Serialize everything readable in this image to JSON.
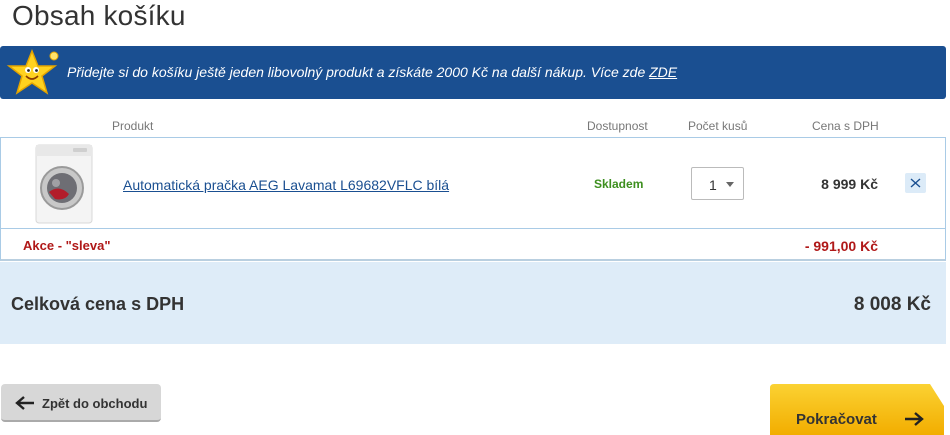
{
  "page_title": "Obsah košíku",
  "promo": {
    "text": "Přidejte si do košíku ještě jeden libovolný produkt a získáte 2000 Kč na další nákup. Více zde ",
    "link": "ZDE"
  },
  "columns": {
    "product": "Produkt",
    "availability": "Dostupnost",
    "quantity": "Počet kusů",
    "price": "Cena s DPH"
  },
  "items": [
    {
      "name": "Automatická pračka AEG Lavamat L69682VFLC bílá",
      "availability": "Skladem",
      "quantity": "1",
      "price": "8 999 Kč"
    }
  ],
  "discount": {
    "label": "Akce - \"sleva\"",
    "value": "- 991,00 Kč"
  },
  "total": {
    "label": "Celková cena s DPH",
    "value": "8 008 Kč"
  },
  "buttons": {
    "back": "Zpět do obchodu",
    "continue": "Pokračovat"
  },
  "colors": {
    "promo_bg": "#1a4f91",
    "available": "#3d8f1f",
    "discount": "#b01818",
    "total_bg": "#deecf8",
    "continue_bg": "#f6bd00"
  },
  "icons": [
    "star-mascot-icon",
    "close-icon",
    "arrow-left-icon",
    "arrow-right-icon",
    "chevron-down-icon"
  ]
}
